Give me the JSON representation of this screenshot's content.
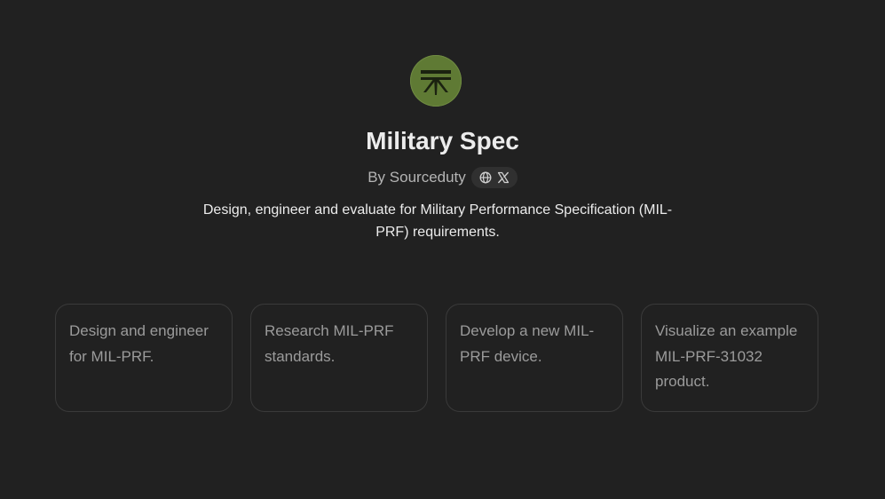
{
  "gpt": {
    "title": "Military Spec",
    "byline": "By Sourceduty",
    "description": "Design, engineer and evaluate for Military Performance Specification (MIL-PRF) requirements.",
    "avatar_icon": "mil-spec-logo-icon",
    "social_icons": [
      "globe-icon",
      "x-logo-icon"
    ],
    "colors": {
      "background": "#212121",
      "avatar": "#5f7a34",
      "title": "#ececec",
      "muted": "#b4b4b4",
      "card_border": "#3a3a3a",
      "card_text": "#9b9b9b"
    }
  },
  "starters": [
    {
      "label": "Design and engineer for MIL-PRF."
    },
    {
      "label": "Research MIL-PRF standards."
    },
    {
      "label": "Develop a new MIL-PRF device."
    },
    {
      "label": "Visualize an example MIL-PRF-31032 product."
    }
  ]
}
